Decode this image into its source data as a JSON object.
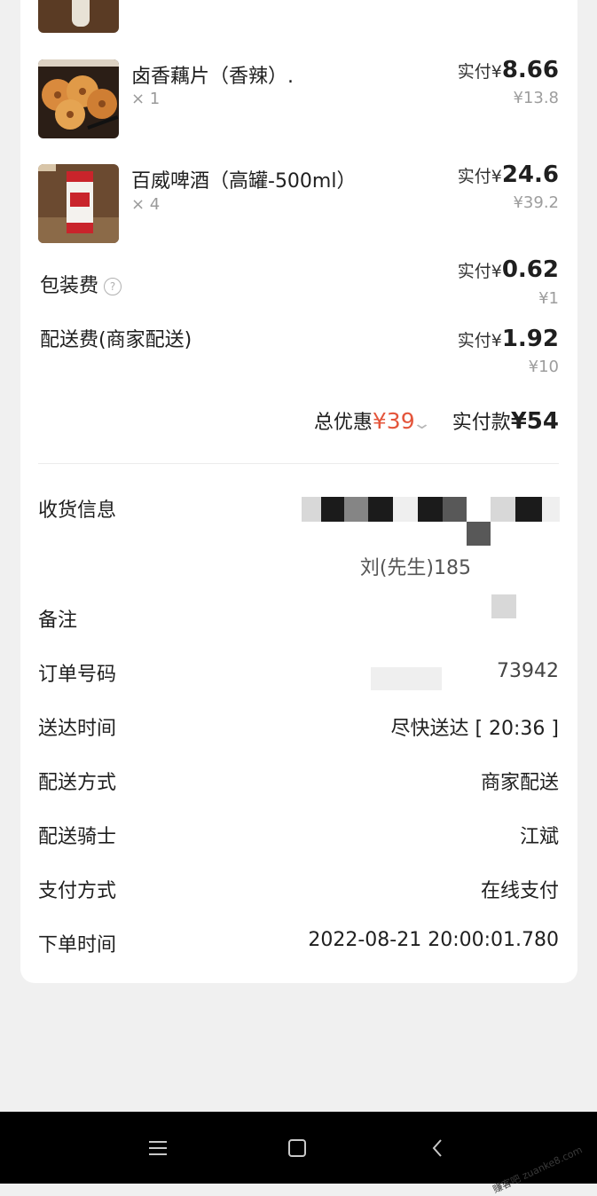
{
  "items": [
    {
      "name": "卤香藕片（香辣）.",
      "qty": "× 1",
      "pay_label": "实付",
      "currency": "¥",
      "pay_amount": "8.66",
      "orig": "¥13.8"
    },
    {
      "name": "百威啤酒（高罐-500ml）",
      "qty": "× 4",
      "pay_label": "实付",
      "currency": "¥",
      "pay_amount": "24.6",
      "orig": "¥39.2"
    }
  ],
  "fees": {
    "packing": {
      "label": "包装费",
      "pay_label": "实付",
      "currency": "¥",
      "pay_amount": "0.62",
      "orig": "¥1",
      "help_icon": "question-circle-icon"
    },
    "delivery": {
      "label": "配送费(商家配送)",
      "pay_label": "实付",
      "currency": "¥",
      "pay_amount": "1.92",
      "orig": "¥10"
    }
  },
  "totals": {
    "discount_label": "总优惠",
    "discount_amount": "¥39",
    "paid_label": "实付款",
    "paid_amount": "¥54"
  },
  "info": {
    "address_label": "收货信息",
    "contact": "刘(先生)185",
    "remark_label": "备注",
    "order_no_label": "订单号码",
    "order_no_value": "73942",
    "delivery_time_label": "送达时间",
    "delivery_time_value": "尽快送达 [ 20:36 ]",
    "delivery_method_label": "配送方式",
    "delivery_method_value": "商家配送",
    "rider_label": "配送骑士",
    "rider_value": "江斌",
    "payment_label": "支付方式",
    "payment_value": "在线支付",
    "order_time_label": "下单时间",
    "order_time_value": "2022-08-21 20:00:01.780"
  },
  "navbar": {
    "menu_icon": "menu-icon",
    "home_icon": "home-square-icon",
    "back_icon": "back-chevron-icon"
  },
  "watermark": "赚客吧 zuanke8.com",
  "colors": {
    "discount": "#e4553b",
    "card": "#ffffff",
    "background": "#f0f0f0"
  }
}
